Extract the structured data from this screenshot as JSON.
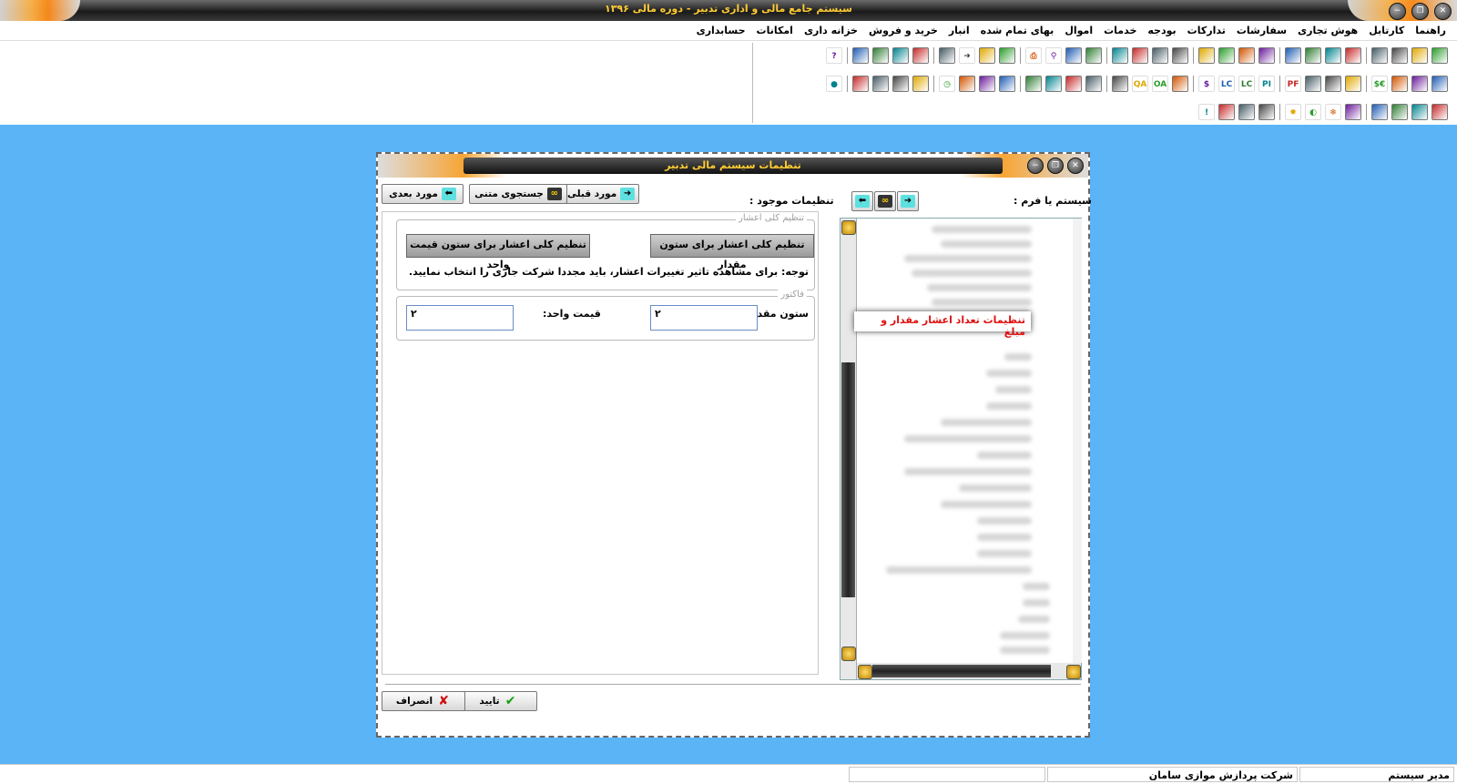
{
  "window": {
    "title": "سیستم جامع مالی و اداری تدبیر - دوره مالی ۱۳۹۶"
  },
  "menu": [
    "حسابداری",
    "امکانات",
    "خزانه داری",
    "خرید و فروش",
    "انبار",
    "بهای تمام شده",
    "اموال",
    "خدمات",
    "بودجه",
    "تدارکات",
    "سفارشات",
    "هوش تجاری",
    "کارتابل",
    "راهنما"
  ],
  "toolbar_rows": [
    [
      "grid-icon",
      "document-icon",
      "check-chart-icon",
      "home-icon",
      "tree-icon",
      "chart-icon",
      "document-icon",
      "layers-icon",
      "book-icon",
      "cube-icon",
      "folder-icon",
      "cube-icon",
      "balance-icon",
      "table-icon",
      "list-icon",
      "list-icon",
      "image-icon",
      "image-icon",
      "search-icon",
      "print-icon",
      "network-icon",
      "window-icon",
      "arrow-icon",
      "exchange-icon",
      "export-icon",
      "calculator-icon",
      "users-icon",
      "printer-icon",
      "help-icon"
    ],
    [
      "chart-icon",
      "report-icon",
      "transfer-icon",
      "dollar-euro-icon",
      "money-icon",
      "building-icon",
      "flag-icon",
      "pf-icon",
      "pi-icon",
      "lc-icon",
      "lc-icon",
      "dollar-icon",
      "bank-icon",
      "oa-icon",
      "qa-icon",
      "triangle-icon",
      "triangle-icon",
      "ledger-icon",
      "ledger-icon",
      "truck-icon",
      "truck-icon",
      "book-icon",
      "tools-icon",
      "clock-icon",
      "binoculars-icon",
      "binoculars-icon",
      "ship-icon",
      "cash-register-icon",
      "globe-icon"
    ],
    [
      "tag-icon",
      "book-icon",
      "box-icon",
      "file-icon",
      "chart-bar-icon",
      "snowflake-icon",
      "moon-icon",
      "sun-icon",
      "palette-icon",
      "display-icon",
      "calculator-icon",
      "warning-icon"
    ]
  ],
  "dialog": {
    "title": "تنظیمات سیستم مالی تدبیر",
    "system_form_label": "سیستم یا فرم :",
    "existing_settings_label": "تنظیمات موجود :",
    "prev_button": "مورد قبلی",
    "text_search_button": "جستجوی متنی",
    "next_button": "مورد بعدی",
    "group_decimal_title": "تنظیم کلی اعشار",
    "btn_qty_decimals": "تنظیم کلی اعشار برای ستون مقدار",
    "btn_price_decimals": "تنظیم کلی اعشار برای ستون قیمت واحد",
    "note": "توجه: برای مشاهده تاثیر تغییرات اعشار، باید مجددا شرکت جاری را انتخاب نمایید.",
    "group_factor_title": "فاکتور",
    "qty_column_label": "ستون مقدار:",
    "qty_column_value": "۲",
    "unit_price_label": "قیمت واحد:",
    "unit_price_value": "۲",
    "tree_selected_item": "تنظیمات تعداد اعشار مقدار و مبلغ",
    "ok_button": "تایید",
    "cancel_button": "انصراف"
  },
  "statusbar": {
    "user": "مدیر سیستم",
    "company": "شرکت پردازش موازی سامان",
    "cell3": "",
    "cell4": ""
  }
}
